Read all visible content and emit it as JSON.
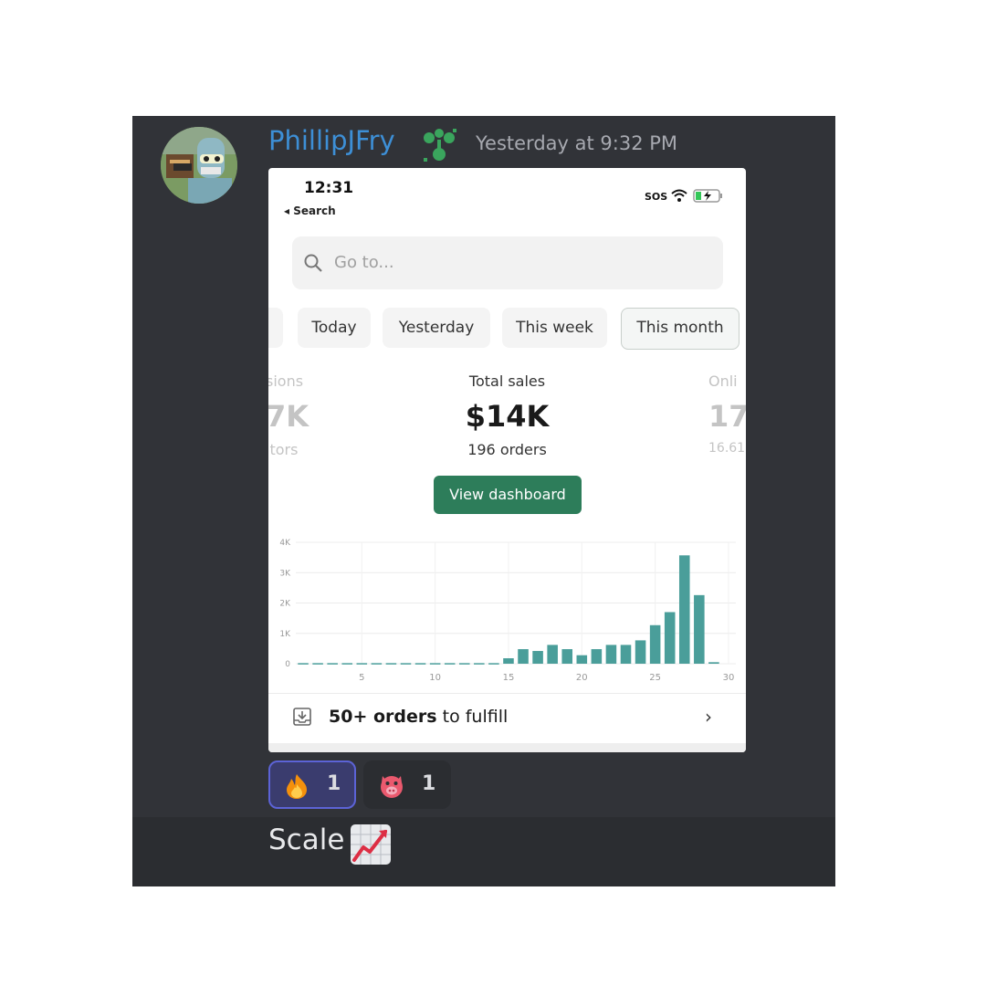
{
  "message": {
    "username": "PhillipJFry",
    "timestamp": "Yesterday at 9:32 PM",
    "text": "Scale"
  },
  "screenshot": {
    "status_bar": {
      "time": "12:31",
      "back_label": "◂ Search",
      "carrier": "SOS"
    },
    "search": {
      "placeholder": "Go to..."
    },
    "date_tabs": [
      {
        "label": "Today"
      },
      {
        "label": "Yesterday"
      },
      {
        "label": "This week"
      },
      {
        "label": "This month",
        "active": true
      }
    ],
    "metrics": {
      "left_partial": {
        "label": "sions",
        "value": "7K",
        "sub": "itors"
      },
      "center": {
        "label": "Total sales",
        "value": "$14K",
        "sub": "196 orders"
      },
      "right_partial": {
        "label": "Onli",
        "value": "17.",
        "sub": "16.61"
      }
    },
    "button": {
      "label": "View dashboard"
    },
    "footer": {
      "bold": "50+ orders",
      "rest": " to fulfill",
      "chevron": "›"
    }
  },
  "reactions": [
    {
      "emoji": "fire-emoji",
      "count": "1",
      "active": true
    },
    {
      "emoji": "pig-emoji",
      "count": "1",
      "active": false
    }
  ],
  "colors": {
    "accent_green": "#2d7d5a",
    "bar_teal": "#4a9e9a",
    "username_blue": "#3d8fd6",
    "reaction_active_border": "#5c63d6"
  },
  "chart_data": {
    "type": "bar",
    "x": [
      1,
      2,
      3,
      4,
      5,
      6,
      7,
      8,
      9,
      10,
      11,
      12,
      13,
      14,
      15,
      16,
      17,
      18,
      19,
      20,
      21,
      22,
      23,
      24,
      25,
      26,
      27,
      28,
      29
    ],
    "values": [
      20,
      20,
      20,
      20,
      20,
      20,
      20,
      20,
      20,
      20,
      20,
      20,
      20,
      20,
      180,
      480,
      420,
      620,
      480,
      280,
      480,
      620,
      620,
      770,
      1270,
      1700,
      3570,
      2260,
      50
    ],
    "ylim": [
      0,
      4000
    ],
    "y_ticks": [
      "0",
      "1K",
      "2K",
      "3K",
      "4K"
    ],
    "x_ticks": [
      "5",
      "10",
      "15",
      "20",
      "25",
      "30"
    ],
    "x_tick_values": [
      5,
      10,
      15,
      20,
      25,
      30
    ],
    "grid": true
  }
}
